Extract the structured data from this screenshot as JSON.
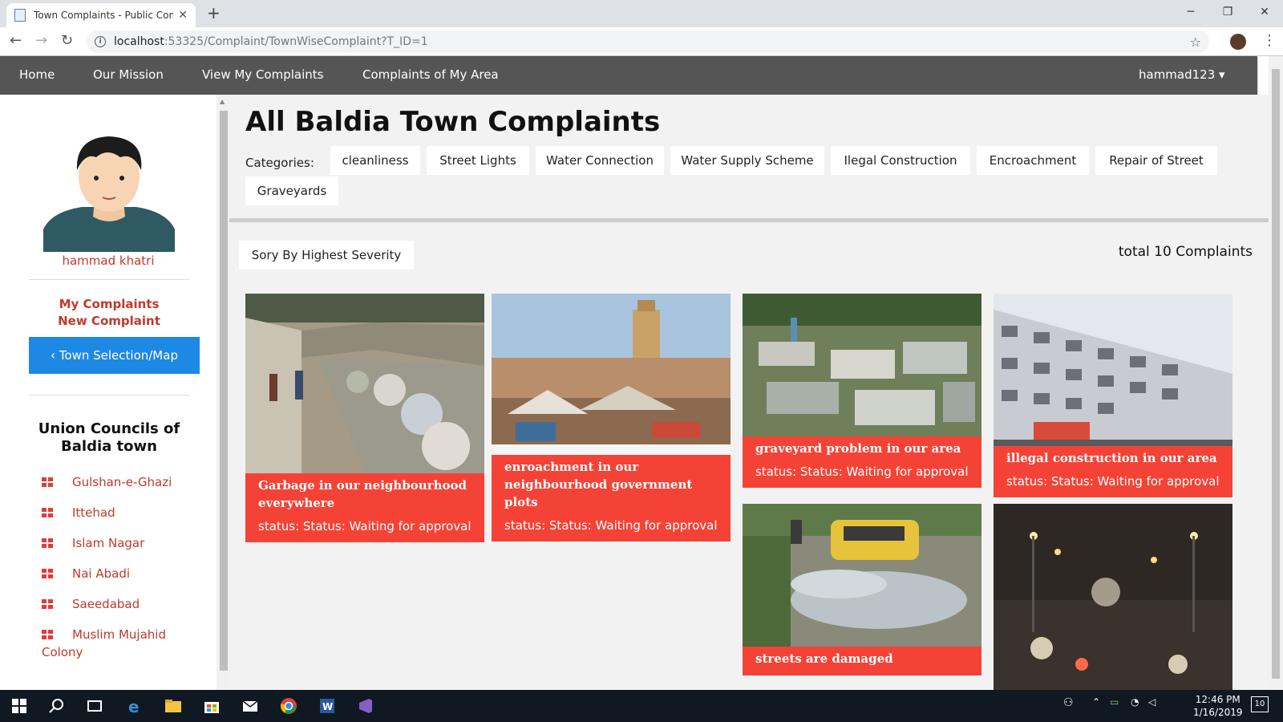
{
  "browser": {
    "tab_title": "Town Complaints - Public Compl",
    "url_host": "localhost",
    "url_path": ":53325/Complaint/TownWiseComplaint?T_ID=1"
  },
  "navbar": {
    "links": [
      "Home",
      "Our Mission",
      "View My Complaints",
      "Complaints of My Area"
    ],
    "user": "hammad123 ▾"
  },
  "sidebar": {
    "user_name": "hammad khatri",
    "my_complaints": "My Complaints",
    "new_complaint": "New Complaint",
    "town_button": "‹ Town Selection/Map",
    "uc_title": "Union Councils of Baldia town",
    "union_councils": [
      "Gulshan-e-Ghazi",
      "Ittehad",
      "Islam Nagar",
      "Nai Abadi",
      "Saeedabad",
      "Muslim Mujahid Colony"
    ]
  },
  "main": {
    "title": "All Baldia Town Complaints",
    "categories_label": "Categories:",
    "categories": [
      "cleanliness",
      "Street Lights",
      "Water Connection",
      "Water Supply Scheme",
      "Ilegal Construction",
      "Encroachment",
      "Repair of Street",
      "Graveyards"
    ],
    "sort_button": "Sory By Highest Severity",
    "total": "total 10 Complaints",
    "cards": [
      {
        "title": "Garbage in our neighbourhood everywhere",
        "status": "status: Status: Waiting for approval"
      },
      {
        "title": "enroachment in our neighbourhood government plots",
        "status": "status: Status: Waiting for approval"
      },
      {
        "title": "graveyard problem in our area",
        "status": "status: Status: Waiting for approval"
      },
      {
        "title": "illegal construction in our area",
        "status": "status: Status: Waiting for approval"
      },
      {
        "title": "streets are damaged",
        "status": ""
      }
    ]
  },
  "taskbar": {
    "time": "12:46 PM",
    "date": "1/16/2019",
    "notifications": "10"
  }
}
